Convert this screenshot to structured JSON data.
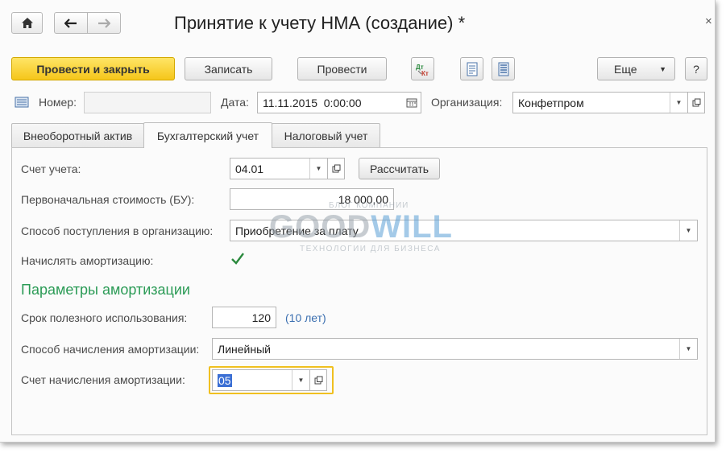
{
  "header": {
    "title": "Принятие к учету НМА (создание) *",
    "close_glyph": "×"
  },
  "toolbar": {
    "post_close_label": "Провести и закрыть",
    "save_label": "Записать",
    "post_label": "Провести",
    "more_label": "Еще",
    "help_label": "?"
  },
  "doc_fields": {
    "number_label": "Номер:",
    "number_value": "",
    "date_label": "Дата:",
    "date_value": "11.11.2015  0:00:00",
    "org_label": "Организация:",
    "org_value": "Конфетпром"
  },
  "tabs": [
    {
      "label": "Внеоборотный актив"
    },
    {
      "label": "Бухгалтерский учет"
    },
    {
      "label": "Налоговый учет"
    }
  ],
  "accounting": {
    "account_label": "Счет учета:",
    "account_value": "04.01",
    "calculate_label": "Рассчитать",
    "initial_cost_label": "Первоначальная стоимость (БУ):",
    "initial_cost_value": "18 000,00",
    "receipt_method_label": "Способ поступления в организацию:",
    "receipt_method_value": "Приобретение за плату",
    "accrue_depr_label": "Начислять амортизацию:",
    "accrue_depr_checked": true,
    "params_title": "Параметры амортизации",
    "useful_life_label": "Срок полезного использования:",
    "useful_life_value": "120",
    "useful_life_hint": "(10 лет)",
    "depr_method_label": "Способ начисления амортизации:",
    "depr_method_value": "Линейный",
    "depr_account_label": "Счет начисления амортизации:",
    "depr_account_value": "05"
  },
  "watermark": {
    "top": "БЛОГ КОМПАНИИ",
    "main_a": "GOOD",
    "main_b": "WILL",
    "bottom": "ТЕХНОЛОГИИ ДЛЯ БИЗНЕСА"
  },
  "colors": {
    "primary_button": "#f5c61a",
    "section_title": "#2b9b56",
    "hint": "#3b6fb0",
    "focus_border": "#f0c020"
  }
}
